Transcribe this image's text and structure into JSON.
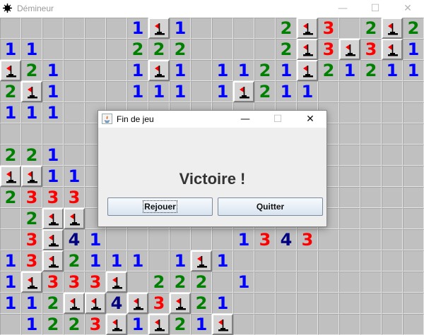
{
  "window": {
    "title": "Démineur",
    "minimize": "—",
    "maximize": "☐",
    "close": "✕"
  },
  "colors": {
    "1": "#0000ff",
    "2": "#008000",
    "3": "#ff0000",
    "4": "#000080",
    "flag": "#ff0000",
    "board": "#c0c0c0"
  },
  "board": {
    "rows": [
      "??????1F1????2F3?2F21?",
      "11????222????2F3F3F1??",
      "F21???1F1?1121F21211??",
      "2F1???111?1F211???????",
      "111???????????????????",
      "??????????????????????",
      "221???????????????????",
      "FF11??????????????????",
      "2333??????????????????",
      "?2FF??????????????????",
      "?3F41??????1343???????",
      "13F2111?1F1???????????",
      "1F333F?222?1??????????",
      "112FF4F3F21?????????F???",
      "?1223F1F21F??????????"
    ]
  },
  "dialog": {
    "title": "Fin de jeu",
    "message": "Victoire !",
    "rejouer": "Rejouer",
    "quitter": "Quitter",
    "minimize": "—",
    "maximize": "☐",
    "close": "✕"
  }
}
